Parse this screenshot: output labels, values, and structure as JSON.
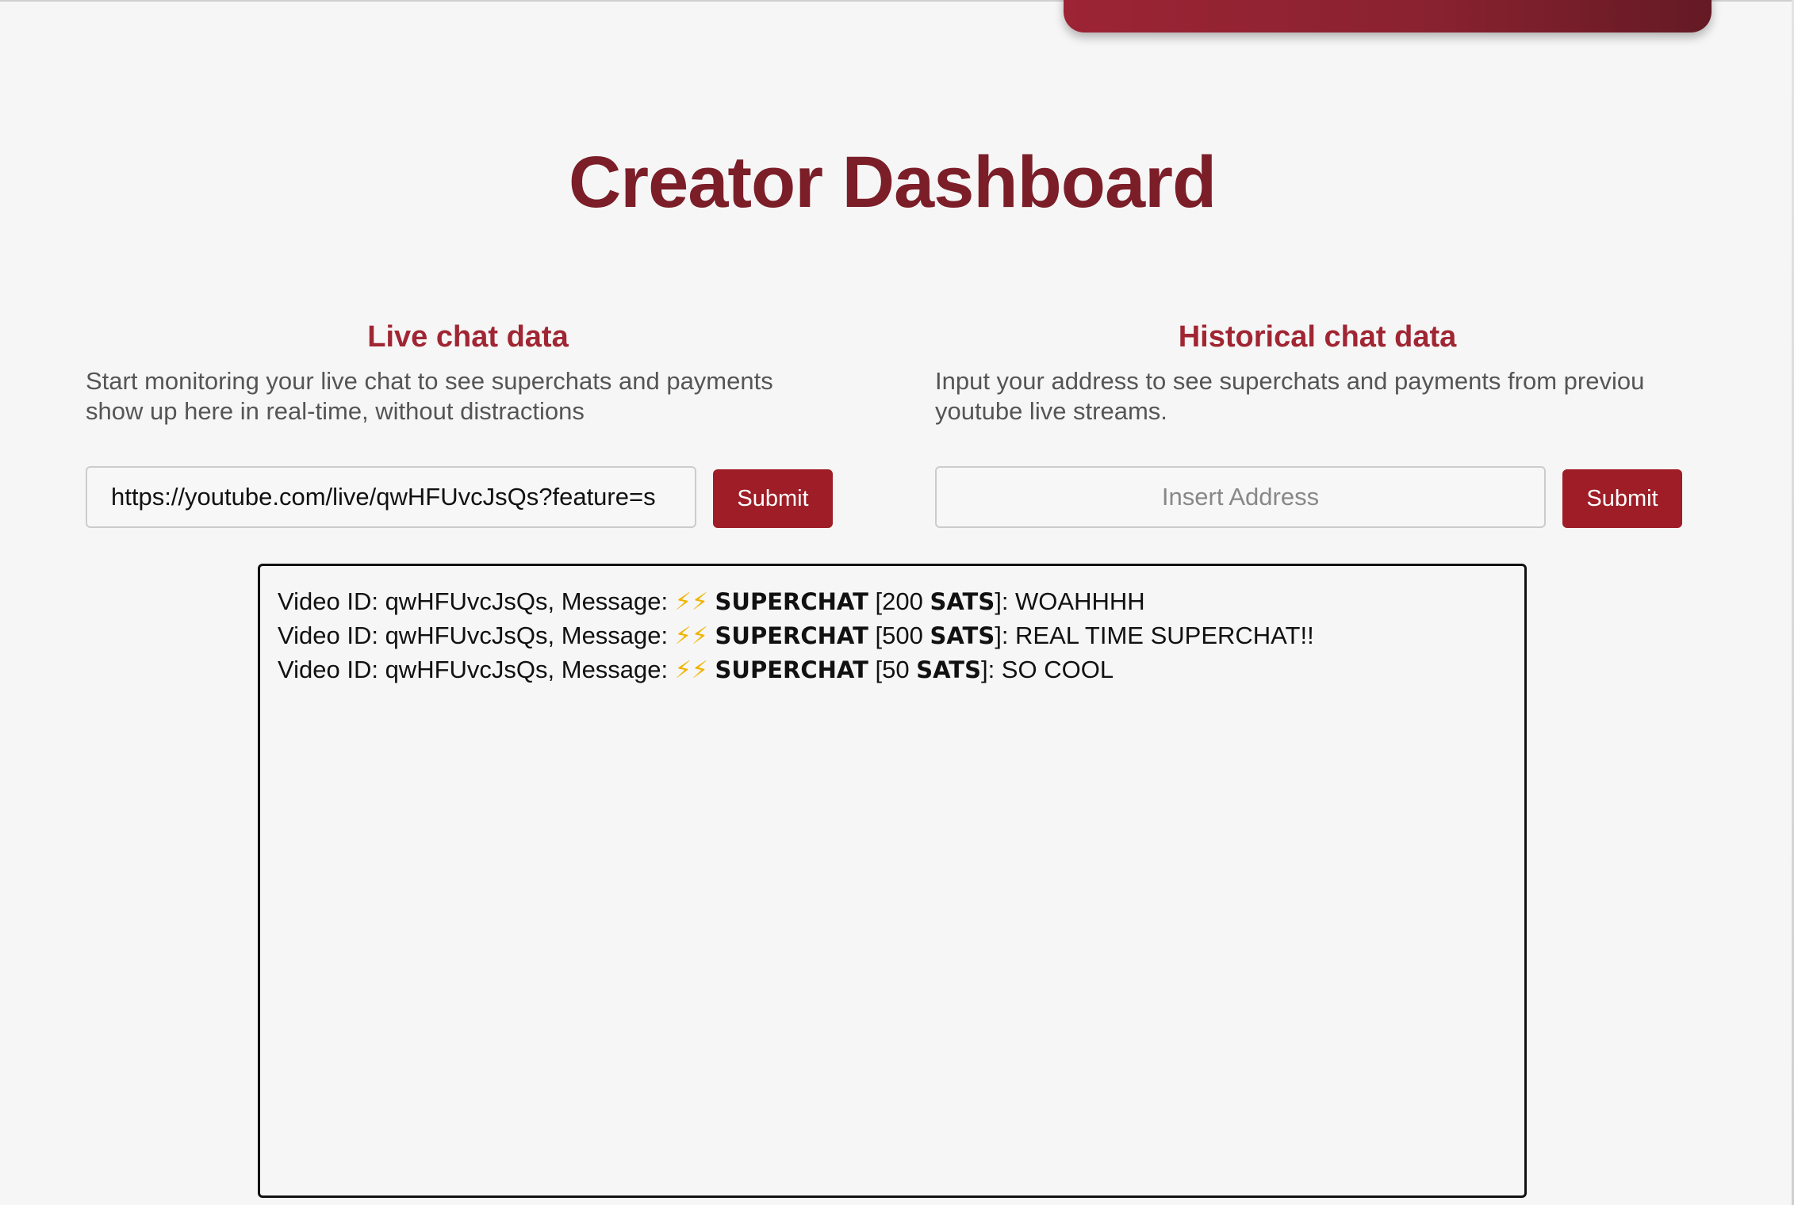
{
  "page": {
    "title": "Creator Dashboard"
  },
  "live": {
    "heading": "Live chat data",
    "description_line1": "Start monitoring your live chat to see superchats and payments",
    "description_line2": "show up here in real-time, without distractions",
    "input_value": "https://youtube.com/live/qwHFUvcJsQs?feature=s",
    "submit_label": "Submit"
  },
  "historical": {
    "heading": "Historical chat data",
    "description_line1": "Input your address to see superchats and payments from previou",
    "description_line2": "youtube live streams.",
    "input_placeholder": "Insert Address",
    "submit_label": "Submit"
  },
  "log": {
    "entries": [
      {
        "prefix": "Video ID: qwHFUvcJsQs, Message: ",
        "bolts": "⚡⚡",
        "keyword": "SUPERCHAT",
        "amount_open": " [200 ",
        "unit": "SATS",
        "rest": "]: WOAHHHH"
      },
      {
        "prefix": "Video ID: qwHFUvcJsQs, Message: ",
        "bolts": "⚡⚡",
        "keyword": "SUPERCHAT",
        "amount_open": " [500 ",
        "unit": "SATS",
        "rest": "]: REAL TIME SUPERCHAT!!"
      },
      {
        "prefix": "Video ID: qwHFUvcJsQs, Message: ",
        "bolts": "⚡⚡",
        "keyword": "SUPERCHAT",
        "amount_open": " [50 ",
        "unit": "SATS",
        "rest": "]: SO COOL"
      }
    ]
  },
  "colors": {
    "title": "#7b1e28",
    "heading": "#a02633",
    "button": "#9e1d26",
    "banner": "#8a2230",
    "bolt": "#f0b400"
  },
  "icons": {
    "bolt": "lightning-bolt-icon"
  }
}
